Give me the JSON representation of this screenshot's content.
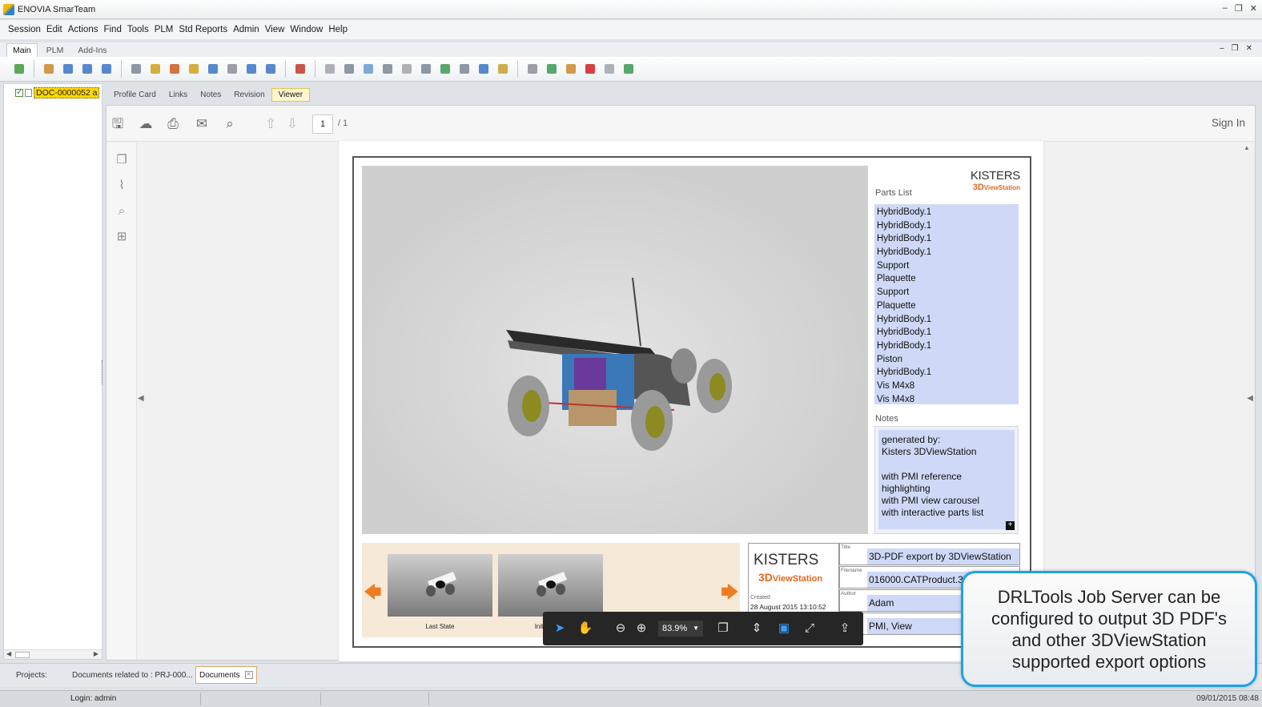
{
  "window": {
    "title": "ENOVIA SmarTeam",
    "controls": [
      "–",
      "❐",
      "✕"
    ]
  },
  "menu": [
    "Session",
    "Edit",
    "Actions",
    "Find",
    "Tools",
    "PLM",
    "Std Reports",
    "Admin",
    "View",
    "Window",
    "Help"
  ],
  "ribbon_tabs": [
    "Main",
    "PLM",
    "Add-Ins"
  ],
  "tree": {
    "item_label": "DOC-0000052 a"
  },
  "doc_tabs": [
    "Profile Card",
    "Links",
    "Notes",
    "Revision",
    "Viewer"
  ],
  "viewer": {
    "page_current": "1",
    "page_total": "/ 1",
    "sign_in": "Sign In",
    "zoom": "83.9%"
  },
  "pdf": {
    "logo_main": "KISTERS",
    "logo_sub": "3D",
    "logo_sub2": "ViewStation",
    "parts_title": "Parts List",
    "parts": [
      "HybridBody.1",
      "HybridBody.1",
      "HybridBody.1",
      "HybridBody.1",
      "Support",
      "Plaquette",
      "Support",
      "Plaquette",
      "HybridBody.1",
      "HybridBody.1",
      "HybridBody.1",
      "Piston",
      "HybridBody.1",
      "Vis M4x8",
      "Vis M4x8"
    ],
    "notes_title": "Notes",
    "notes_text": "generated by:\nKisters 3DViewStation\n\nwith PMI reference\nhighlighting\nwith PMI view carousel\nwith interactive parts list",
    "carousel_captions": [
      "Last State",
      "Initial State"
    ],
    "created_label": "Created",
    "created_value": "28 August 2015 13:10:52",
    "info": [
      {
        "label": "Title",
        "value": "3D-PDF export by 3DViewStation"
      },
      {
        "label": "Filename",
        "value": "016000.CATProduct.3dvs"
      },
      {
        "label": "Author",
        "value": "Adam"
      },
      {
        "label": "",
        "value": "PMI, View"
      }
    ]
  },
  "bottom": {
    "projects_label": "Projects:",
    "docs_related": "Documents related to : PRJ-000...",
    "documents_tab": "Documents"
  },
  "status": {
    "login": "Login: admin",
    "timestamp": "09/01/2015 08:48"
  },
  "callout": {
    "text": "DRLTools Job Server can be\nconfigured to output 3D PDF's\nand other 3DViewStation\nsupported export options"
  },
  "colors": {
    "callout_border": "#1aa3e8",
    "kisters_orange": "#e5661d",
    "parts_bg": "#cfd9f7",
    "tree_highlight": "#ffd800"
  }
}
